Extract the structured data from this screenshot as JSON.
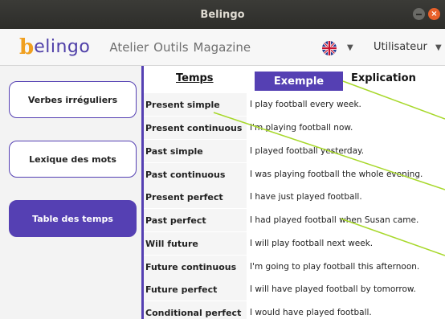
{
  "window": {
    "title": "Belingo",
    "close_glyph": "×"
  },
  "app": {
    "logo_letter": "b",
    "logo_rest": "elingo",
    "nav": [
      "Atelier",
      "Outils",
      "Magazine"
    ],
    "user_label": "Utilisateur",
    "language_icon": "uk-flag-icon"
  },
  "sidebar": {
    "items": [
      {
        "label": "Verbes irréguliers",
        "active": false
      },
      {
        "label": "Lexique des mots",
        "active": false
      },
      {
        "label": "Table des temps",
        "active": true
      }
    ]
  },
  "tabs": {
    "temps": "Temps",
    "exemple": "Exemple",
    "explication": "Explication"
  },
  "rows": [
    {
      "tense": "Present simple",
      "example": "I play football every week."
    },
    {
      "tense": "Present continuous",
      "example": "I'm playing football now."
    },
    {
      "tense": "Past simple",
      "example": "I played football yesterday."
    },
    {
      "tense": "Past continuous",
      "example": "I was playing football the whole evening."
    },
    {
      "tense": "Present perfect",
      "example": "I have just played football."
    },
    {
      "tense": "Past perfect",
      "example": "I had played football when Susan came."
    },
    {
      "tense": "Will future",
      "example": "I will play football next week."
    },
    {
      "tense": "Future continuous",
      "example": "I'm going to play football this afternoon."
    },
    {
      "tense": "Future perfect",
      "example": "I will have played football by tomorrow."
    },
    {
      "tense": "Conditional perfect",
      "example": "I would have played football."
    }
  ],
  "colors": {
    "accent": "#5540b3",
    "logo_orange": "#f0a020",
    "annotation_line": "#a7d82a"
  }
}
